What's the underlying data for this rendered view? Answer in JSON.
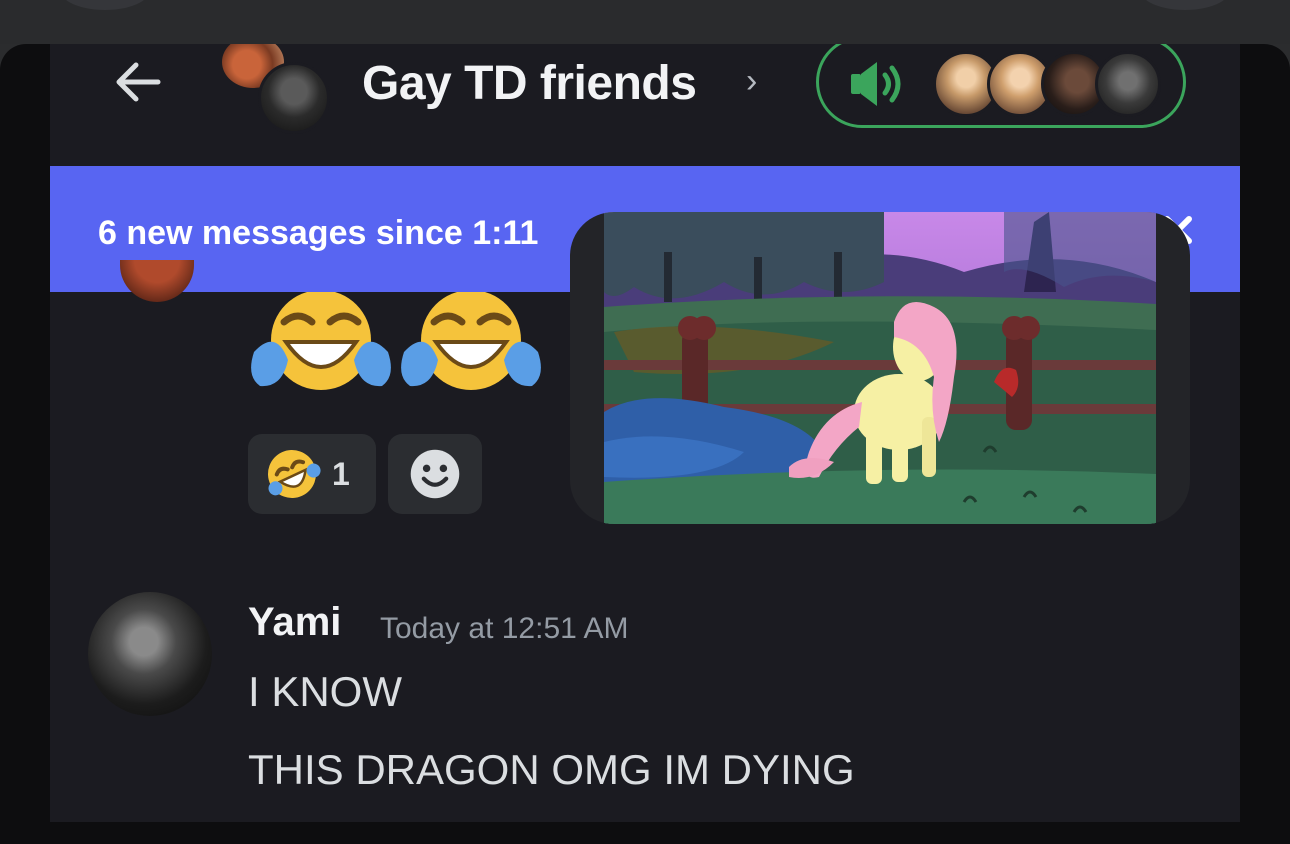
{
  "header": {
    "title": "Gay TD friends",
    "chevron": "›",
    "back_icon": "arrow-left-icon",
    "speaker_icon": "speaker-icon"
  },
  "banner": {
    "text": "6 new messages since 1:11",
    "close_icon": "close-icon"
  },
  "reactions": [
    {
      "emoji": "rolling-on-floor-laughing-icon",
      "count": "1"
    },
    {
      "emoji": "add-reaction-icon"
    }
  ],
  "message": {
    "author": "Yami",
    "timestamp": "Today at 12:51 AM",
    "lines": [
      "I KNOW",
      "THIS DRAGON OMG IM DYING"
    ]
  },
  "colors": {
    "accent": "#5865f2",
    "voice_green": "#3ba55c",
    "background": "#1b1b21"
  }
}
